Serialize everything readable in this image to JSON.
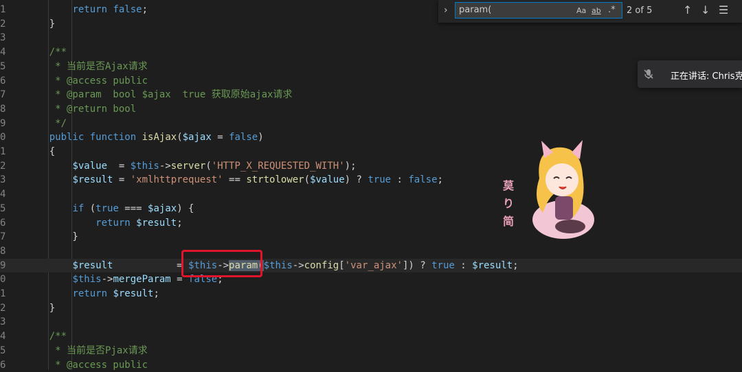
{
  "editor": {
    "lines": [
      {
        "ln": "1",
        "segments": [
          {
            "t": "        ",
            "c": ""
          },
          {
            "t": "return",
            "c": "c-kw"
          },
          {
            "t": " ",
            "c": ""
          },
          {
            "t": "false",
            "c": "c-kw"
          },
          {
            "t": ";",
            "c": "c-punc"
          }
        ]
      },
      {
        "ln": "2",
        "segments": [
          {
            "t": "    }",
            "c": "c-punc"
          }
        ]
      },
      {
        "ln": "3",
        "segments": []
      },
      {
        "ln": "4",
        "segments": [
          {
            "t": "    /**",
            "c": "c-comment"
          }
        ]
      },
      {
        "ln": "5",
        "segments": [
          {
            "t": "     * 当前是否Ajax请求",
            "c": "c-comment"
          }
        ]
      },
      {
        "ln": "6",
        "segments": [
          {
            "t": "     * @access public",
            "c": "c-comment"
          }
        ]
      },
      {
        "ln": "7",
        "segments": [
          {
            "t": "     * @param  bool $ajax  true 获取原始ajax请求",
            "c": "c-comment"
          }
        ]
      },
      {
        "ln": "8",
        "segments": [
          {
            "t": "     * @return bool",
            "c": "c-comment"
          }
        ]
      },
      {
        "ln": "9",
        "segments": [
          {
            "t": "     */",
            "c": "c-comment"
          }
        ]
      },
      {
        "ln": "0",
        "segments": [
          {
            "t": "    ",
            "c": ""
          },
          {
            "t": "public",
            "c": "c-kw"
          },
          {
            "t": " ",
            "c": ""
          },
          {
            "t": "function",
            "c": "c-kw"
          },
          {
            "t": " ",
            "c": ""
          },
          {
            "t": "isAjax",
            "c": "c-fn"
          },
          {
            "t": "(",
            "c": "c-punc"
          },
          {
            "t": "$ajax",
            "c": "c-var"
          },
          {
            "t": " = ",
            "c": "c-punc"
          },
          {
            "t": "false",
            "c": "c-kw"
          },
          {
            "t": ")",
            "c": "c-punc"
          }
        ]
      },
      {
        "ln": "1",
        "segments": [
          {
            "t": "    {",
            "c": "c-punc"
          }
        ]
      },
      {
        "ln": "2",
        "segments": [
          {
            "t": "        ",
            "c": ""
          },
          {
            "t": "$value",
            "c": "c-var"
          },
          {
            "t": "  = ",
            "c": "c-punc"
          },
          {
            "t": "$this",
            "c": "c-this"
          },
          {
            "t": "->",
            "c": "c-punc"
          },
          {
            "t": "server",
            "c": "c-fn"
          },
          {
            "t": "(",
            "c": "c-punc"
          },
          {
            "t": "'HTTP_X_REQUESTED_WITH'",
            "c": "c-str"
          },
          {
            "t": ");",
            "c": "c-punc"
          }
        ]
      },
      {
        "ln": "3",
        "segments": [
          {
            "t": "        ",
            "c": ""
          },
          {
            "t": "$result",
            "c": "c-var"
          },
          {
            "t": " = ",
            "c": "c-punc"
          },
          {
            "t": "'xmlhttprequest'",
            "c": "c-str"
          },
          {
            "t": " == ",
            "c": "c-punc"
          },
          {
            "t": "strtolower",
            "c": "c-fn"
          },
          {
            "t": "(",
            "c": "c-punc"
          },
          {
            "t": "$value",
            "c": "c-var"
          },
          {
            "t": ") ? ",
            "c": "c-punc"
          },
          {
            "t": "true",
            "c": "c-kw"
          },
          {
            "t": " : ",
            "c": "c-punc"
          },
          {
            "t": "false",
            "c": "c-kw"
          },
          {
            "t": ";",
            "c": "c-punc"
          }
        ]
      },
      {
        "ln": "4",
        "segments": []
      },
      {
        "ln": "5",
        "segments": [
          {
            "t": "        ",
            "c": ""
          },
          {
            "t": "if",
            "c": "c-kw"
          },
          {
            "t": " (",
            "c": "c-punc"
          },
          {
            "t": "true",
            "c": "c-kw"
          },
          {
            "t": " === ",
            "c": "c-punc"
          },
          {
            "t": "$ajax",
            "c": "c-var"
          },
          {
            "t": ") {",
            "c": "c-punc"
          }
        ]
      },
      {
        "ln": "6",
        "segments": [
          {
            "t": "            ",
            "c": ""
          },
          {
            "t": "return",
            "c": "c-kw"
          },
          {
            "t": " ",
            "c": ""
          },
          {
            "t": "$result",
            "c": "c-var"
          },
          {
            "t": ";",
            "c": "c-punc"
          }
        ]
      },
      {
        "ln": "7",
        "segments": [
          {
            "t": "        }",
            "c": "c-punc"
          }
        ]
      },
      {
        "ln": "8",
        "segments": []
      },
      {
        "ln": "9",
        "segments": [
          {
            "t": "        ",
            "c": ""
          },
          {
            "t": "$result",
            "c": "c-var"
          },
          {
            "t": "           = ",
            "c": "c-punc"
          },
          {
            "t": "$this",
            "c": "c-this"
          },
          {
            "t": "->",
            "c": "c-punc"
          },
          {
            "t": "param",
            "c": "c-fn match-hl"
          },
          {
            "t": "(",
            "c": "c-punc match-hl"
          },
          {
            "t": "$this",
            "c": "c-this"
          },
          {
            "t": "->",
            "c": "c-punc"
          },
          {
            "t": "config",
            "c": "c-fn"
          },
          {
            "t": "[",
            "c": "c-punc"
          },
          {
            "t": "'var_ajax'",
            "c": "c-str"
          },
          {
            "t": "]) ? ",
            "c": "c-punc"
          },
          {
            "t": "true",
            "c": "c-kw"
          },
          {
            "t": " : ",
            "c": "c-punc"
          },
          {
            "t": "$result",
            "c": "c-var"
          },
          {
            "t": ";",
            "c": "c-punc"
          }
        ]
      },
      {
        "ln": "0",
        "segments": [
          {
            "t": "        ",
            "c": ""
          },
          {
            "t": "$this",
            "c": "c-this"
          },
          {
            "t": "->",
            "c": "c-punc"
          },
          {
            "t": "mergeParam",
            "c": "c-var"
          },
          {
            "t": " = ",
            "c": "c-punc"
          },
          {
            "t": "false",
            "c": "c-kw"
          },
          {
            "t": ";",
            "c": "c-punc"
          }
        ]
      },
      {
        "ln": "1",
        "segments": [
          {
            "t": "        ",
            "c": ""
          },
          {
            "t": "return",
            "c": "c-kw"
          },
          {
            "t": " ",
            "c": ""
          },
          {
            "t": "$result",
            "c": "c-var"
          },
          {
            "t": ";",
            "c": "c-punc"
          }
        ]
      },
      {
        "ln": "2",
        "segments": [
          {
            "t": "    }",
            "c": "c-punc"
          }
        ]
      },
      {
        "ln": "3",
        "segments": []
      },
      {
        "ln": "4",
        "segments": [
          {
            "t": "    /**",
            "c": "c-comment"
          }
        ]
      },
      {
        "ln": "5",
        "segments": [
          {
            "t": "     * 当前是否Pjax请求",
            "c": "c-comment"
          }
        ]
      },
      {
        "ln": "6",
        "segments": [
          {
            "t": "     * @access public",
            "c": "c-comment"
          }
        ]
      }
    ]
  },
  "find_widget": {
    "query": "param(",
    "match_case_label": "Aa",
    "whole_word_label": "ab",
    "regex_label": ".*",
    "result_count": "2 of 5",
    "icons": [
      "chevron-right-icon",
      "arrow-up-icon",
      "arrow-down-icon",
      "find-in-selection-icon"
    ]
  },
  "toast": {
    "text": "正在讲话: Chris克",
    "icon": "muted-microphone-icon"
  },
  "sticker": {
    "text": "莫 り 简"
  },
  "colors": {
    "background": "#1e1e1e",
    "comment": "#6a9955",
    "keyword": "#569cd6",
    "variable": "#9cdcfe",
    "function": "#dcdcaa",
    "string": "#ce9178",
    "highlight_box": "#e0142b"
  }
}
